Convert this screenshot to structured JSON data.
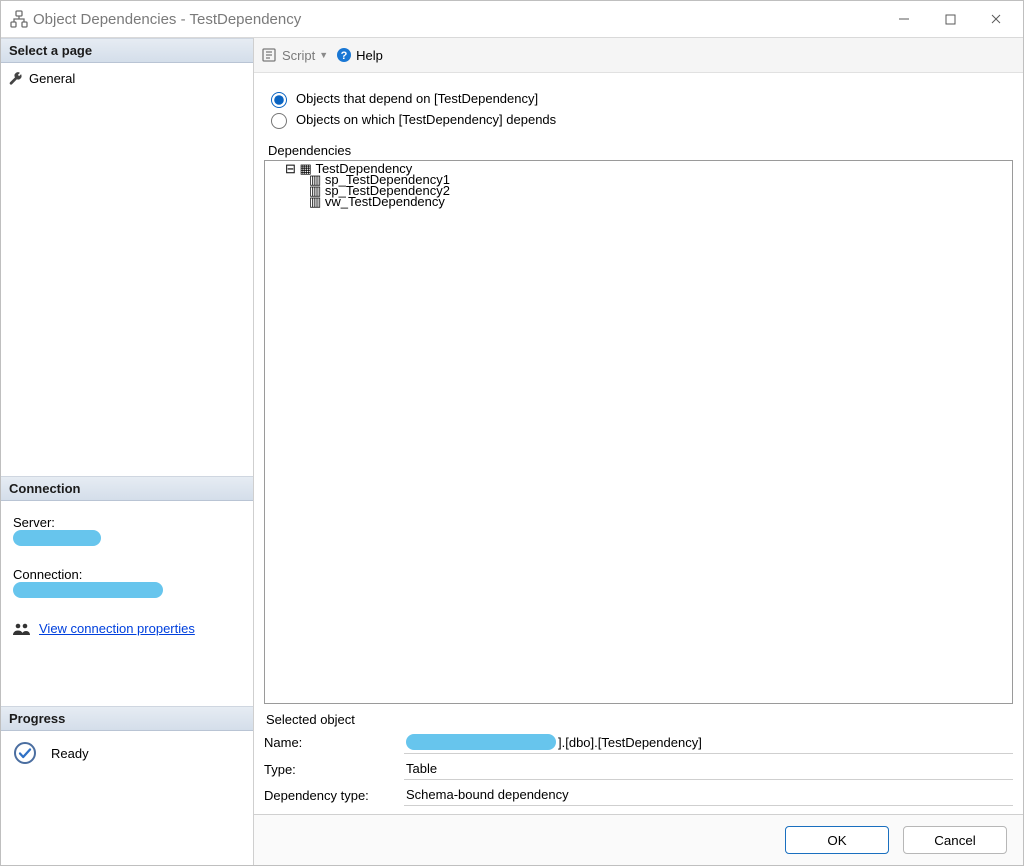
{
  "window": {
    "title": "Object Dependencies - TestDependency"
  },
  "caption": {
    "minimize": "–",
    "maximize": "▢",
    "close": "✕"
  },
  "sidebar": {
    "select_page_header": "Select a page",
    "general_item": "General",
    "connection_header": "Connection",
    "server_label": "Server:",
    "connection_label": "Connection:",
    "view_props_link": "View connection properties",
    "progress_header": "Progress",
    "progress_status": "Ready"
  },
  "toolbar": {
    "script_label": "Script",
    "help_label": "Help"
  },
  "radios": {
    "depend_on_label": "Objects that depend on [TestDependency]",
    "depends_label": "Objects on which [TestDependency] depends",
    "selected": "depend_on"
  },
  "dependencies_label": "Dependencies",
  "tree": {
    "root": "TestDependency",
    "children": [
      "sp_TestDependency1",
      "sp_TestDependency2",
      "vw_TestDependency"
    ]
  },
  "selected": {
    "header": "Selected object",
    "name_label": "Name:",
    "name_suffix": "].[dbo].[TestDependency]",
    "type_label": "Type:",
    "type_value": "Table",
    "dep_type_label": "Dependency type:",
    "dep_type_value": "Schema-bound dependency"
  },
  "footer": {
    "ok": "OK",
    "cancel": "Cancel"
  }
}
